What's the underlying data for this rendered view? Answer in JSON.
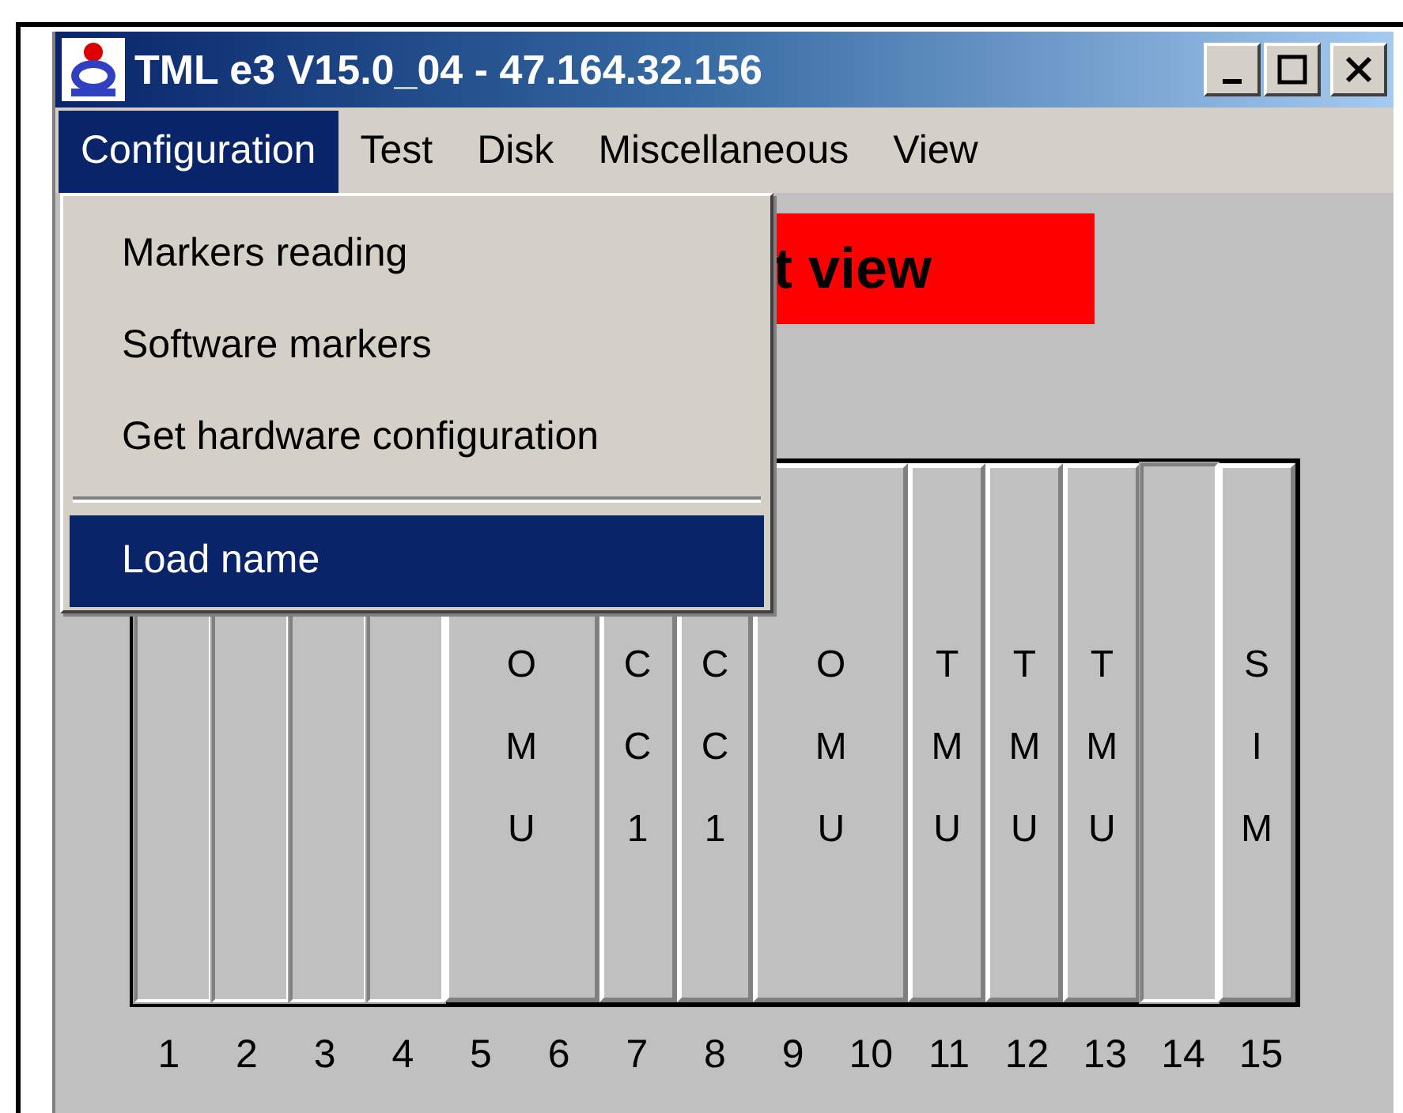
{
  "window": {
    "title": "TML e3 V15.0_04 - 47.164.32.156"
  },
  "menu_bar": [
    {
      "label": "Configuration",
      "selected": true
    },
    {
      "label": "Test",
      "selected": false
    },
    {
      "label": "Disk",
      "selected": false
    },
    {
      "label": "Miscellaneous",
      "selected": false
    },
    {
      "label": "View",
      "selected": false
    }
  ],
  "dropdown": [
    {
      "kind": "item",
      "label": "Markers reading",
      "selected": false
    },
    {
      "kind": "item",
      "label": "Software markers",
      "selected": false
    },
    {
      "kind": "item",
      "label": "Get hardware configuration",
      "selected": false
    },
    {
      "kind": "separator"
    },
    {
      "kind": "item",
      "label": "Load name",
      "selected": true
    }
  ],
  "banner": {
    "text": "t view"
  },
  "rack": {
    "modules": [
      {
        "kind": "empty"
      },
      {
        "kind": "empty"
      },
      {
        "kind": "empty"
      },
      {
        "kind": "empty"
      },
      {
        "kind": "module",
        "letters": [
          "O",
          "M",
          "U"
        ],
        "wide": true
      },
      {
        "kind": "module",
        "letters": [
          "C",
          "C",
          "1"
        ],
        "wide": false
      },
      {
        "kind": "module",
        "letters": [
          "C",
          "C",
          "1"
        ],
        "wide": false
      },
      {
        "kind": "module",
        "letters": [
          "O",
          "M",
          "U"
        ],
        "wide": true
      },
      {
        "kind": "module",
        "letters": [
          "T",
          "M",
          "U"
        ],
        "wide": false
      },
      {
        "kind": "module",
        "letters": [
          "T",
          "M",
          "U"
        ],
        "wide": false
      },
      {
        "kind": "module",
        "letters": [
          "T",
          "M",
          "U"
        ],
        "wide": false
      },
      {
        "kind": "empty"
      },
      {
        "kind": "module",
        "letters": [
          "S",
          "I",
          "M"
        ],
        "wide": false
      }
    ],
    "slot_numbers": [
      "1",
      "2",
      "3",
      "4",
      "5",
      "6",
      "7",
      "8",
      "9",
      "10",
      "11",
      "12",
      "13",
      "14",
      "15"
    ]
  }
}
